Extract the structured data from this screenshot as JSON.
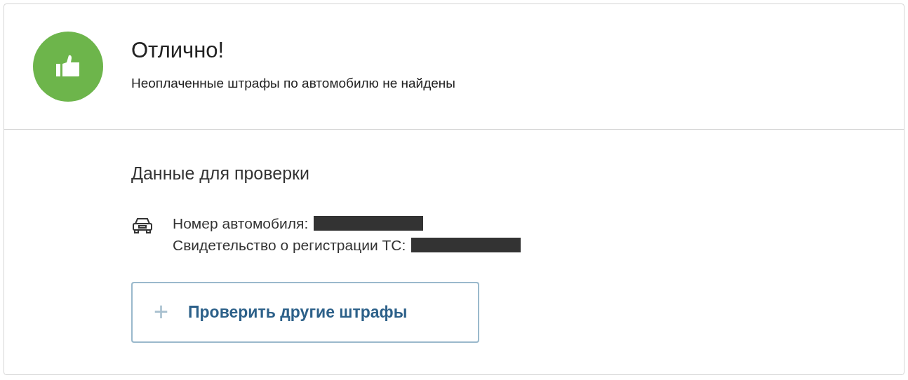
{
  "result": {
    "title": "Отлично!",
    "message": "Неоплаченные штрафы по автомобилю не найдены"
  },
  "check_data": {
    "heading": "Данные для проверки",
    "fields": [
      {
        "label": "Номер автомобиля:",
        "redacted": true
      },
      {
        "label": "Свидетельство о регистрации ТС:",
        "redacted": true
      }
    ]
  },
  "button": {
    "icon": "+",
    "label": "Проверить другие штрафы"
  }
}
